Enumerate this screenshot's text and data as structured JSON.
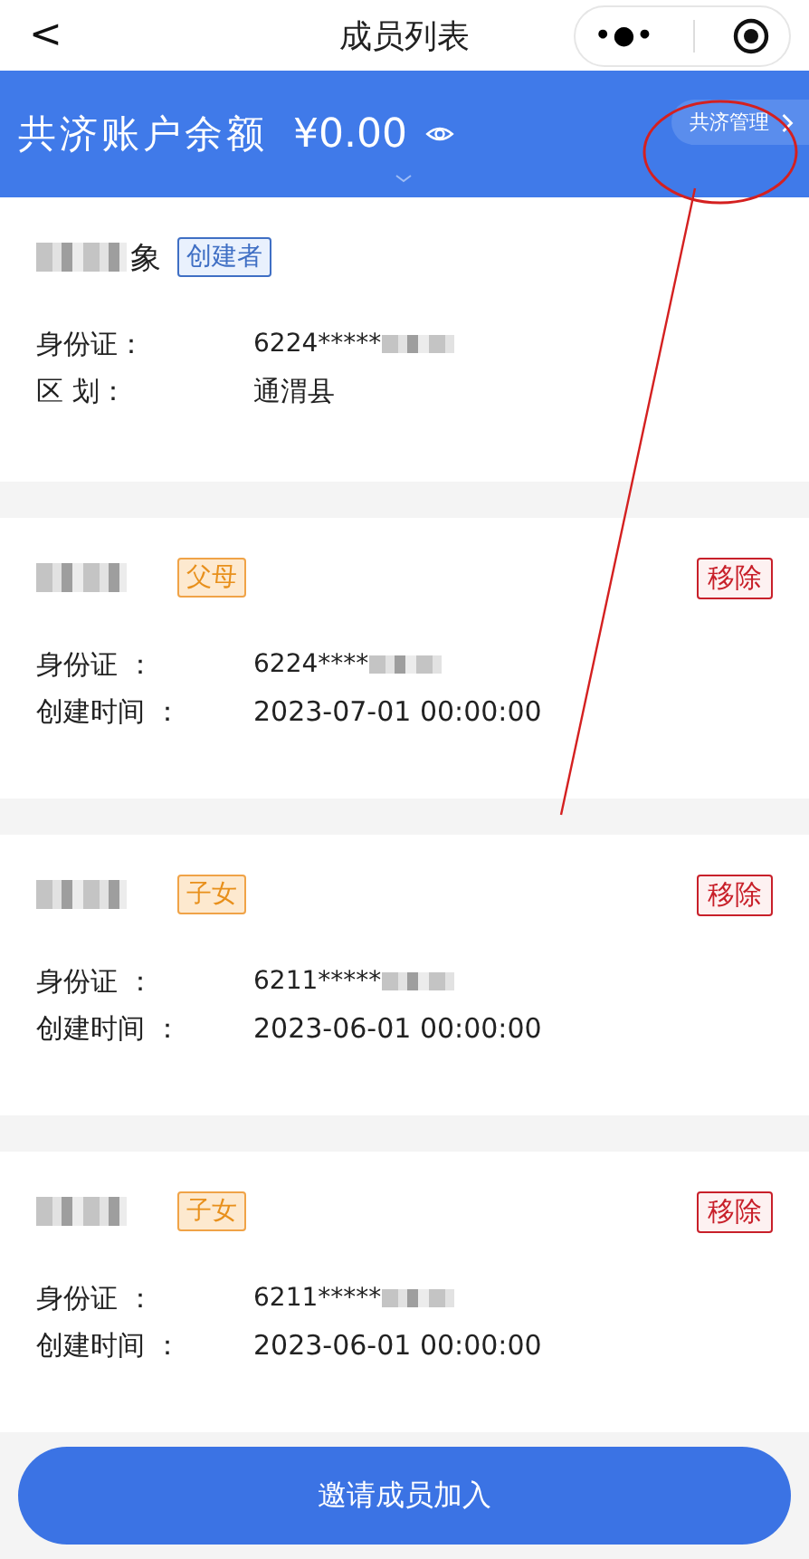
{
  "nav": {
    "back": "<",
    "title": "成员列表",
    "more": "•●•"
  },
  "banner": {
    "label": "共济账户余额",
    "amount": "¥0.00",
    "manage": "共济管理"
  },
  "members": [
    {
      "name_visible": "象",
      "tag": {
        "label": "创建者",
        "kind": "creator"
      },
      "removable": false,
      "fields": [
        {
          "label": "身份证：",
          "value": "6224*****",
          "masked": true
        },
        {
          "label": "区 划：",
          "value": "通渭县",
          "masked": false
        }
      ]
    },
    {
      "tag": {
        "label": "父母",
        "kind": "family"
      },
      "removable": true,
      "remove_label": "移除",
      "fields": [
        {
          "label": "身份证 ：",
          "value": "6224****",
          "masked": true
        },
        {
          "label": "创建时间 ：",
          "value": "2023-07-01 00:00:00",
          "masked": false
        }
      ]
    },
    {
      "tag": {
        "label": "子女",
        "kind": "family"
      },
      "removable": true,
      "remove_label": "移除",
      "fields": [
        {
          "label": "身份证 ：",
          "value": "6211*****",
          "masked": true
        },
        {
          "label": "创建时间 ：",
          "value": "2023-06-01 00:00:00",
          "masked": false
        }
      ]
    },
    {
      "tag": {
        "label": "子女",
        "kind": "family"
      },
      "removable": true,
      "remove_label": "移除",
      "fields": [
        {
          "label": "身份证 ：",
          "value": "6211*****",
          "masked": true
        },
        {
          "label": "创建时间 ：",
          "value": "2023-06-01 00:00:00",
          "masked": false
        }
      ]
    }
  ],
  "invite_button": "邀请成员加入"
}
